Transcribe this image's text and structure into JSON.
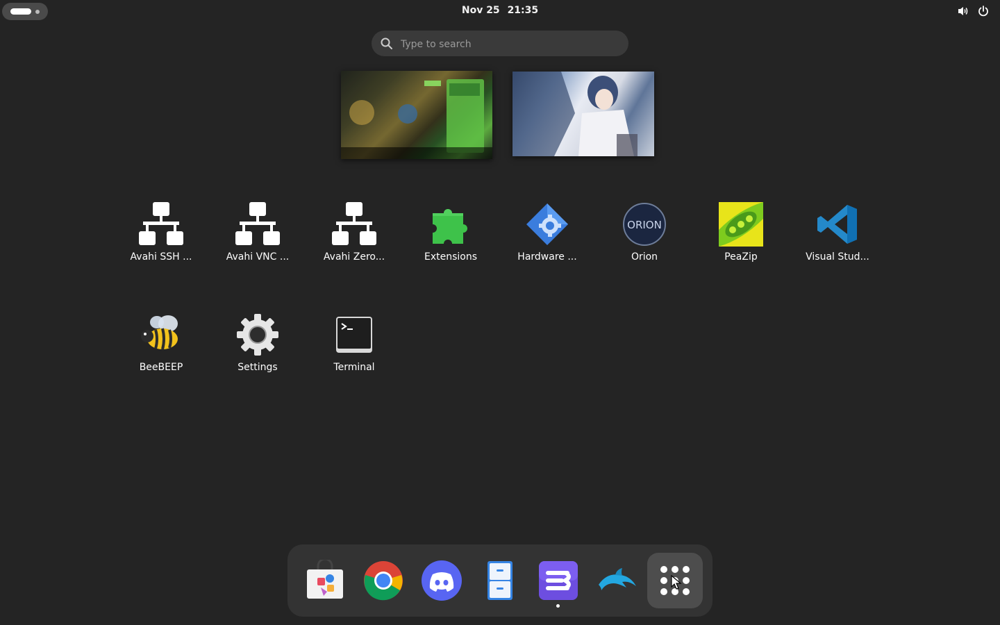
{
  "topbar": {
    "activities_label": "",
    "clock_date": "Nov 25",
    "clock_time": "21:35",
    "tray": [
      "volume-icon",
      "power-icon"
    ]
  },
  "search": {
    "placeholder": "Type to search",
    "value": ""
  },
  "workspaces": [
    {
      "name": "workspace-1"
    },
    {
      "name": "workspace-2"
    }
  ],
  "apps": [
    {
      "label": "Avahi SSH ...",
      "icon": "network-icon"
    },
    {
      "label": "Avahi VNC ...",
      "icon": "network-icon"
    },
    {
      "label": "Avahi Zero...",
      "icon": "network-icon"
    },
    {
      "label": "Extensions",
      "icon": "puzzle-icon"
    },
    {
      "label": "Hardware ...",
      "icon": "hardware-gear-icon"
    },
    {
      "label": "Orion",
      "icon": "orion-icon"
    },
    {
      "label": "PeaZip",
      "icon": "peazip-icon"
    },
    {
      "label": "Visual Stud...",
      "icon": "vscode-icon"
    },
    {
      "label": "BeeBEEP",
      "icon": "bee-icon"
    },
    {
      "label": "Settings",
      "icon": "gear-icon"
    },
    {
      "label": "Terminal",
      "icon": "terminal-icon"
    }
  ],
  "dock": [
    {
      "name": "software-store",
      "icon": "store-bag-icon",
      "running": false
    },
    {
      "name": "chrome",
      "icon": "chrome-icon",
      "running": false
    },
    {
      "name": "discord",
      "icon": "discord-icon",
      "running": false
    },
    {
      "name": "files",
      "icon": "file-cabinet-icon",
      "running": false
    },
    {
      "name": "text-editor",
      "icon": "text-editor-icon",
      "running": true
    },
    {
      "name": "dolphin-emulator",
      "icon": "dolphin-icon",
      "running": false
    },
    {
      "name": "show-apps",
      "icon": "app-grid-icon",
      "running": false,
      "active": true
    }
  ],
  "colors": {
    "background": "#242424",
    "dock": "#333333",
    "search": "#3a3a3a",
    "accent_green": "#3ec24a",
    "vscode_blue": "#2489ca"
  }
}
